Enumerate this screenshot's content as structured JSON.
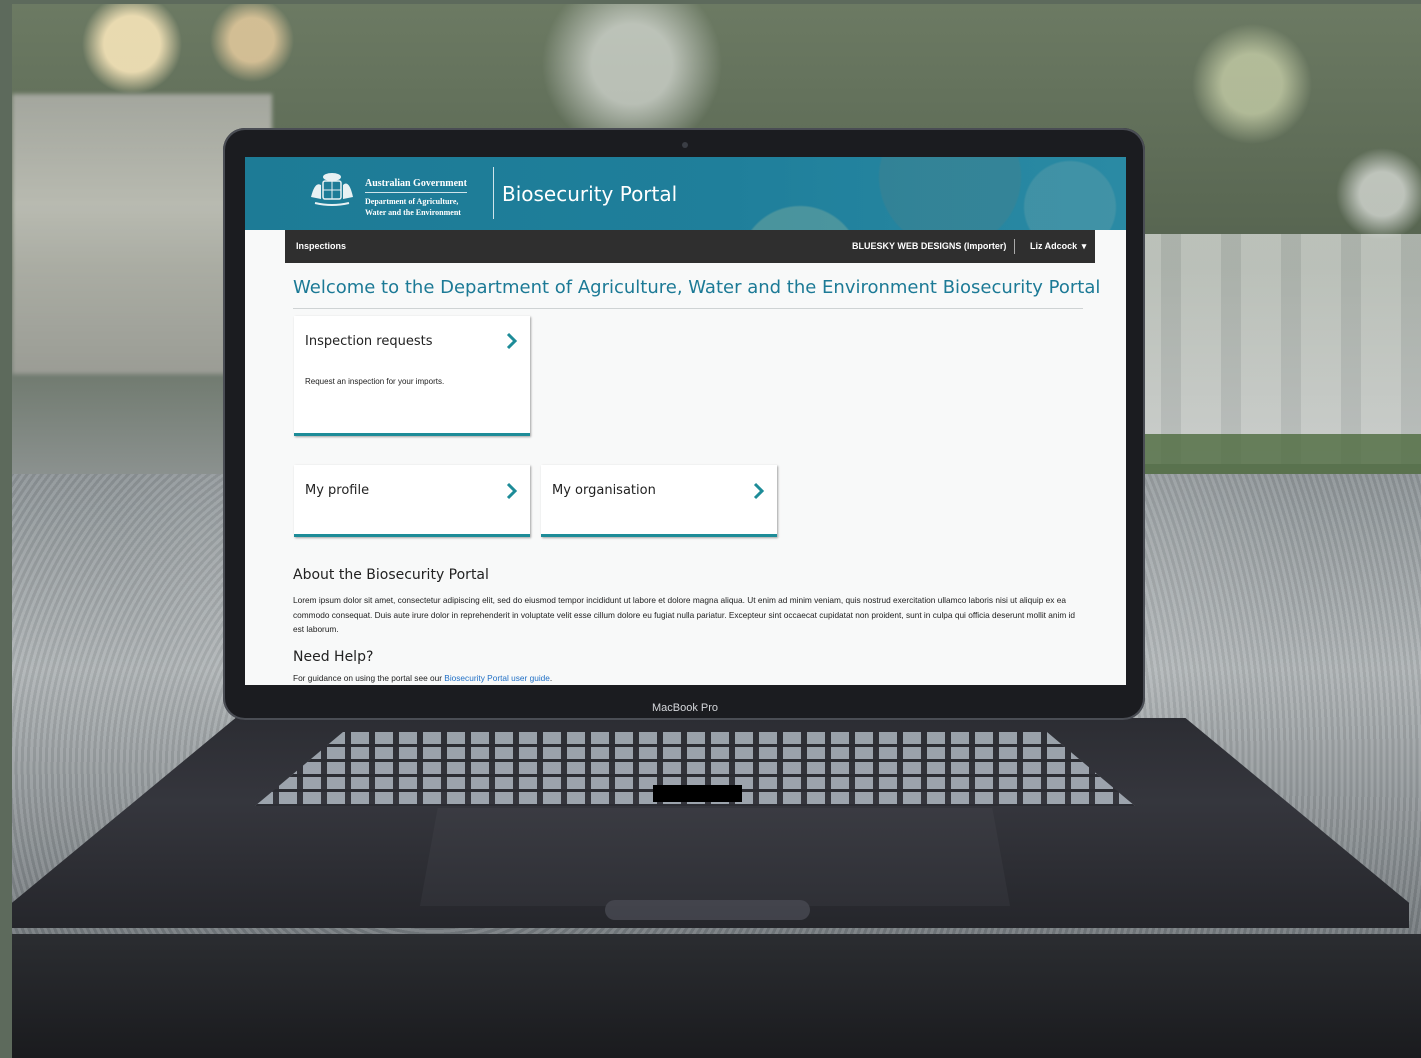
{
  "device": {
    "model_label": "MacBook Pro"
  },
  "header": {
    "gov_line": "Australian Government",
    "dept_line1": "Department of Agriculture,",
    "dept_line2": "Water and the Environment",
    "portal_title": "Biosecurity Portal"
  },
  "nav": {
    "inspections": "Inspections",
    "org": "BLUESKY WEB DESIGNS (Importer)",
    "user": "Liz Adcock",
    "user_caret": "▾"
  },
  "main": {
    "welcome": "Welcome to the Department of Agriculture, Water and the Environment Biosecurity Portal",
    "cards": {
      "inspection": {
        "title": "Inspection requests",
        "desc": "Request an inspection for your imports."
      },
      "profile": {
        "title": "My profile"
      },
      "organisation": {
        "title": "My organisation"
      }
    },
    "about": {
      "heading": "About the Biosecurity Portal",
      "text": "Lorem ipsum dolor sit amet, consectetur adipiscing elit, sed do eiusmod tempor incididunt ut labore et dolore magna aliqua. Ut enim ad minim veniam, quis nostrud exercitation ullamco laboris nisi ut aliquip ex ea commodo consequat. Duis aute irure dolor in reprehenderit in voluptate velit esse cillum dolore eu fugiat nulla pariatur. Excepteur sint occaecat cupidatat non proident, sunt in culpa qui officia deserunt mollit anim id est laborum."
    },
    "help": {
      "heading": "Need Help?",
      "text_before": "For guidance on using the portal see our ",
      "link": "Biosecurity Portal user guide",
      "text_after": "."
    }
  },
  "colors": {
    "brand_teal": "#1d7b96",
    "nav_dark": "#2f2f2f",
    "card_accent": "#1d8c98",
    "link_blue": "#1f6fc5"
  },
  "icons": {
    "card_arrow": "chevron-right-icon",
    "user_menu": "caret-down-icon",
    "crest": "coat-of-arms-icon"
  }
}
